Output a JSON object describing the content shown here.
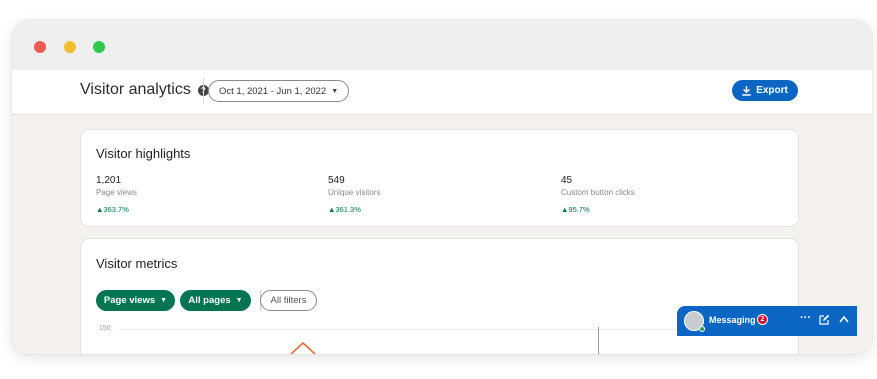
{
  "header": {
    "title": "Visitor analytics",
    "help_icon": "question-circle-icon",
    "date_range": "Oct 1, 2021 - Jun 1, 2022",
    "export_label": "Export",
    "export_icon": "download-icon"
  },
  "highlights": {
    "title": "Visitor highlights",
    "stats": [
      {
        "value": "1,201",
        "label": "Page views",
        "change": "363.7%"
      },
      {
        "value": "549",
        "label": "Unique visitors",
        "change": "361.3%"
      },
      {
        "value": "45",
        "label": "Custom button clicks",
        "change": "95.7%"
      }
    ]
  },
  "metrics": {
    "title": "Visitor metrics",
    "filters": {
      "metric": "Page views",
      "pages": "All pages",
      "all_filters": "All filters"
    },
    "y_tick": "150"
  },
  "messaging": {
    "label": "Messaging",
    "badge_count": "2"
  },
  "colors": {
    "accent_blue": "#0a66c2",
    "filter_green": "#01754f",
    "positive_green": "#057642",
    "chart_peak": "#e8693a"
  }
}
